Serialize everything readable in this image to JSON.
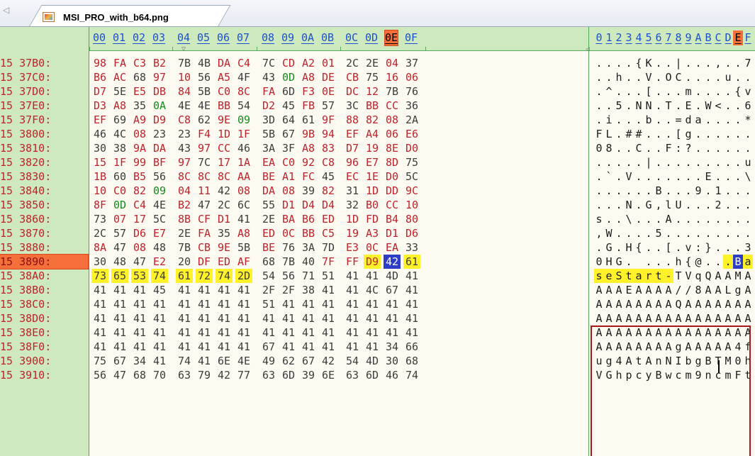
{
  "tabs": {
    "scroll_left_icon": "triangle-left-icon",
    "active": {
      "label": "MSI_PRO_with_b64.png",
      "icon": "png-image-icon"
    }
  },
  "header": {
    "hex_columns": [
      "00",
      "01",
      "02",
      "03",
      "04",
      "05",
      "06",
      "07",
      "08",
      "09",
      "0A",
      "0B",
      "0C",
      "0D",
      "0E",
      "0F"
    ],
    "text_columns": [
      "0",
      "1",
      "2",
      "3",
      "4",
      "5",
      "6",
      "7",
      "8",
      "9",
      "A",
      "B",
      "C",
      "D",
      "E",
      "F"
    ],
    "highlighted_column": "0E"
  },
  "rows": [
    {
      "segment": "15",
      "offset": "37B0:",
      "bytes": [
        "98",
        "FA",
        "C3",
        "B2",
        "7B",
        "4B",
        "DA",
        "C4",
        "7C",
        "CD",
        "A2",
        "01",
        "2C",
        "2E",
        "04",
        "37"
      ],
      "text": "....{K..|...,..7"
    },
    {
      "segment": "15",
      "offset": "37C0:",
      "bytes": [
        "B6",
        "AC",
        "68",
        "97",
        "10",
        "56",
        "A5",
        "4F",
        "43",
        "0D",
        "A8",
        "DE",
        "CB",
        "75",
        "16",
        "06"
      ],
      "text": "..h..V.OC....u.."
    },
    {
      "segment": "15",
      "offset": "37D0:",
      "bytes": [
        "D7",
        "5E",
        "E5",
        "DB",
        "84",
        "5B",
        "C0",
        "8C",
        "FA",
        "6D",
        "F3",
        "0E",
        "DC",
        "12",
        "7B",
        "76"
      ],
      "text": ".^...[...m....{v"
    },
    {
      "segment": "15",
      "offset": "37E0:",
      "bytes": [
        "D3",
        "A8",
        "35",
        "0A",
        "4E",
        "4E",
        "BB",
        "54",
        "D2",
        "45",
        "FB",
        "57",
        "3C",
        "BB",
        "CC",
        "36"
      ],
      "text": "..5.NN.T.E.W<..6"
    },
    {
      "segment": "15",
      "offset": "37F0:",
      "bytes": [
        "EF",
        "69",
        "A9",
        "D9",
        "C8",
        "62",
        "9E",
        "09",
        "3D",
        "64",
        "61",
        "9F",
        "88",
        "82",
        "08",
        "2A"
      ],
      "text": ".i...b..=da....*"
    },
    {
      "segment": "15",
      "offset": "3800:",
      "bytes": [
        "46",
        "4C",
        "08",
        "23",
        "23",
        "F4",
        "1D",
        "1F",
        "5B",
        "67",
        "9B",
        "94",
        "EF",
        "A4",
        "06",
        "E6"
      ],
      "text": "FL.##...[g......"
    },
    {
      "segment": "15",
      "offset": "3810:",
      "bytes": [
        "30",
        "38",
        "9A",
        "DA",
        "43",
        "97",
        "CC",
        "46",
        "3A",
        "3F",
        "A8",
        "83",
        "D7",
        "19",
        "8E",
        "D0"
      ],
      "text": "08..C..F:?......"
    },
    {
      "segment": "15",
      "offset": "3820:",
      "bytes": [
        "15",
        "1F",
        "99",
        "BF",
        "97",
        "7C",
        "17",
        "1A",
        "EA",
        "C0",
        "92",
        "C8",
        "96",
        "E7",
        "8D",
        "75"
      ],
      "text": ".....|.........u"
    },
    {
      "segment": "15",
      "offset": "3830:",
      "bytes": [
        "1B",
        "60",
        "B5",
        "56",
        "8C",
        "8C",
        "8C",
        "AA",
        "BE",
        "A1",
        "FC",
        "45",
        "EC",
        "1E",
        "D0",
        "5C"
      ],
      "text": ".`.V.......E...\\"
    },
    {
      "segment": "15",
      "offset": "3840:",
      "bytes": [
        "10",
        "C0",
        "82",
        "09",
        "04",
        "11",
        "42",
        "08",
        "DA",
        "08",
        "39",
        "82",
        "31",
        "1D",
        "DD",
        "9C"
      ],
      "text": "......B...9.1..."
    },
    {
      "segment": "15",
      "offset": "3850:",
      "bytes": [
        "8F",
        "0D",
        "C4",
        "4E",
        "B2",
        "47",
        "2C",
        "6C",
        "55",
        "D1",
        "D4",
        "D4",
        "32",
        "B0",
        "CC",
        "10"
      ],
      "text": "...N.G,lU...2..."
    },
    {
      "segment": "15",
      "offset": "3860:",
      "bytes": [
        "73",
        "07",
        "17",
        "5C",
        "8B",
        "CF",
        "D1",
        "41",
        "2E",
        "BA",
        "B6",
        "ED",
        "1D",
        "FD",
        "B4",
        "80"
      ],
      "text": "s..\\...A........"
    },
    {
      "segment": "15",
      "offset": "3870:",
      "bytes": [
        "2C",
        "57",
        "D6",
        "E7",
        "2E",
        "FA",
        "35",
        "A8",
        "ED",
        "0C",
        "BB",
        "C5",
        "19",
        "A3",
        "D1",
        "D6"
      ],
      "text": ",W....5........."
    },
    {
      "segment": "15",
      "offset": "3880:",
      "bytes": [
        "8A",
        "47",
        "08",
        "48",
        "7B",
        "CB",
        "9E",
        "5B",
        "BE",
        "76",
        "3A",
        "7D",
        "E3",
        "0C",
        "EA",
        "33"
      ],
      "text": ".G.H{..[.v:}...3"
    },
    {
      "segment": "15",
      "offset": "3890:",
      "bytes": [
        "30",
        "48",
        "47",
        "E2",
        "20",
        "DF",
        "ED",
        "AF",
        "68",
        "7B",
        "40",
        "7F",
        "FF",
        "D9",
        "42",
        "61"
      ],
      "text": "0HG. ...h{@...Ba"
    },
    {
      "segment": "15",
      "offset": "38A0:",
      "bytes": [
        "73",
        "65",
        "53",
        "74",
        "61",
        "72",
        "74",
        "2D",
        "54",
        "56",
        "71",
        "51",
        "41",
        "41",
        "4D",
        "41"
      ],
      "text": "seStart-TVqQAAMA"
    },
    {
      "segment": "15",
      "offset": "38B0:",
      "bytes": [
        "41",
        "41",
        "41",
        "45",
        "41",
        "41",
        "41",
        "41",
        "2F",
        "2F",
        "38",
        "41",
        "41",
        "4C",
        "67",
        "41"
      ],
      "text": "AAAEAAAA//8AALgA"
    },
    {
      "segment": "15",
      "offset": "38C0:",
      "bytes": [
        "41",
        "41",
        "41",
        "41",
        "41",
        "41",
        "41",
        "41",
        "51",
        "41",
        "41",
        "41",
        "41",
        "41",
        "41",
        "41"
      ],
      "text": "AAAAAAAAQAAAAAAA"
    },
    {
      "segment": "15",
      "offset": "38D0:",
      "bytes": [
        "41",
        "41",
        "41",
        "41",
        "41",
        "41",
        "41",
        "41",
        "41",
        "41",
        "41",
        "41",
        "41",
        "41",
        "41",
        "41"
      ],
      "text": "AAAAAAAAAAAAAAAA"
    },
    {
      "segment": "15",
      "offset": "38E0:",
      "bytes": [
        "41",
        "41",
        "41",
        "41",
        "41",
        "41",
        "41",
        "41",
        "41",
        "41",
        "41",
        "41",
        "41",
        "41",
        "41",
        "41"
      ],
      "text": "AAAAAAAAAAAAAAAA"
    },
    {
      "segment": "15",
      "offset": "38F0:",
      "bytes": [
        "41",
        "41",
        "41",
        "41",
        "41",
        "41",
        "41",
        "41",
        "67",
        "41",
        "41",
        "41",
        "41",
        "41",
        "34",
        "66"
      ],
      "text": "AAAAAAAAgAAAAA4f"
    },
    {
      "segment": "15",
      "offset": "3900:",
      "bytes": [
        "75",
        "67",
        "34",
        "41",
        "74",
        "41",
        "6E",
        "4E",
        "49",
        "62",
        "67",
        "42",
        "54",
        "4D",
        "30",
        "68"
      ],
      "text": "ug4AtAnNIbgBTM0h"
    },
    {
      "segment": "15",
      "offset": "3910:",
      "bytes": [
        "56",
        "47",
        "68",
        "70",
        "63",
        "79",
        "42",
        "77",
        "63",
        "6D",
        "39",
        "6E",
        "63",
        "6D",
        "46",
        "74"
      ],
      "text": "VGhpcyBwcm9ncmFt"
    }
  ],
  "selection": {
    "active_row_offset": "3890:",
    "cursor_byte": "42",
    "cursor_char": "B"
  },
  "colors": {
    "gutter": "#cfe9bf",
    "background": "#fdfaf1",
    "address": "#c0222b",
    "header": "#1c4fd1",
    "selection": "#fff22a",
    "cursor": "#2d3ec4",
    "highlight_column": "#f56f3b",
    "annotation_box": "#a51b1b"
  }
}
